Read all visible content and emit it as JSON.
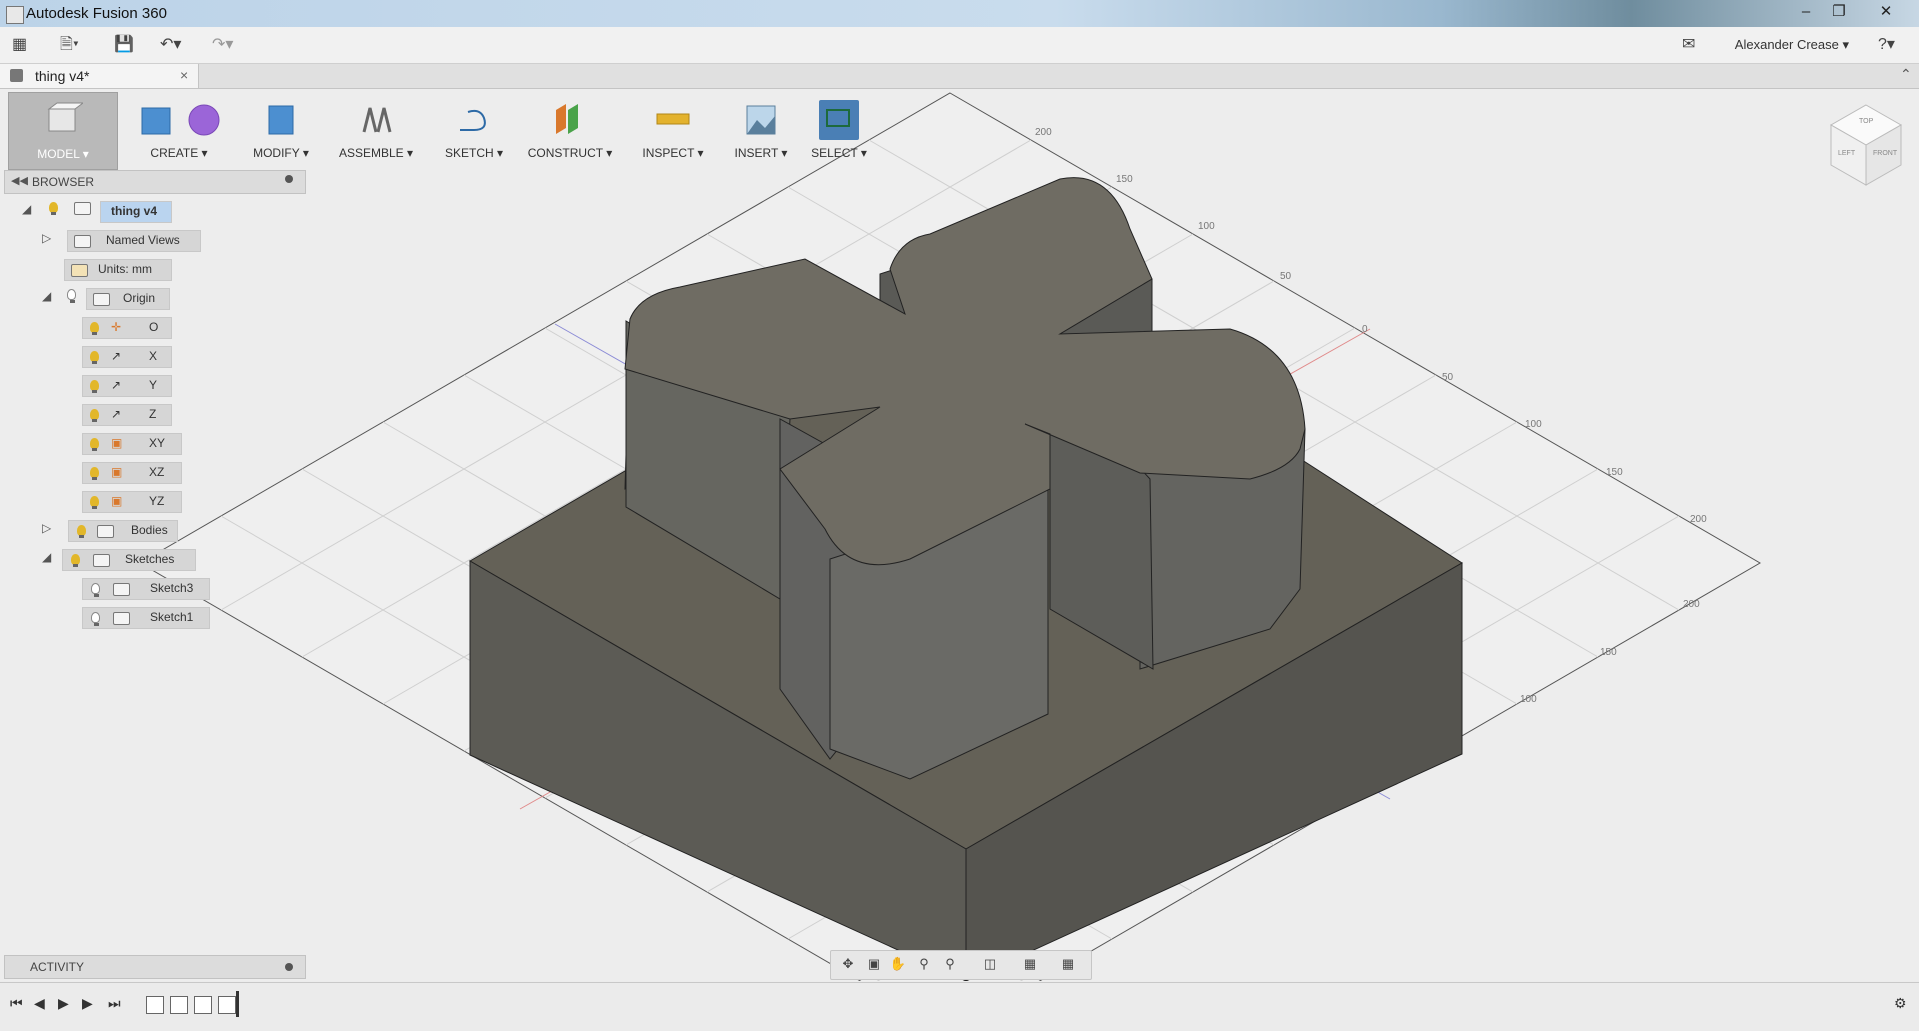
{
  "window": {
    "title": "Autodesk Fusion 360"
  },
  "quick_access": {
    "user_name": "Alexander Crease ▾",
    "help": "?"
  },
  "document_tab": {
    "label": "thing v4*",
    "close": "×"
  },
  "toolbar": {
    "items": [
      {
        "label": "MODEL ▾",
        "icon": "model-icon"
      },
      {
        "label": "CREATE ▾",
        "icon": "create-icon"
      },
      {
        "label": "MODIFY ▾",
        "icon": "modify-icon"
      },
      {
        "label": "ASSEMBLE ▾",
        "icon": "assemble-icon"
      },
      {
        "label": "SKETCH ▾",
        "icon": "sketch-icon"
      },
      {
        "label": "CONSTRUCT ▾",
        "icon": "construct-icon"
      },
      {
        "label": "INSPECT ▾",
        "icon": "inspect-icon"
      },
      {
        "label": "INSERT ▾",
        "icon": "insert-icon"
      },
      {
        "label": "SELECT ▾",
        "icon": "select-icon"
      }
    ]
  },
  "browser": {
    "title": "BROWSER",
    "root": "thing v4",
    "named_views": "Named Views",
    "units": "Units: mm",
    "origin": "Origin",
    "origin_items": [
      "O",
      "X",
      "Y",
      "Z",
      "XY",
      "XZ",
      "YZ"
    ],
    "bodies": "Bodies",
    "sketches": "Sketches",
    "sketch_items": [
      "Sketch3",
      "Sketch1"
    ]
  },
  "activity": {
    "title": "ACTIVITY"
  },
  "grid_labels": {
    "top_left": [
      "200",
      "150",
      "100",
      "50"
    ],
    "right": [
      "0",
      "50",
      "100",
      "150",
      "200"
    ],
    "bottom_right": [
      "200",
      "150",
      "100"
    ]
  },
  "view_cube": {
    "top": "TOP",
    "left": "LEFT",
    "front": "FRONT"
  },
  "colors": {
    "model_top": "#6e6b62",
    "model_side": "#5a5952",
    "accent_select": "#4a7fb5",
    "bulb": "#e2b72a"
  }
}
